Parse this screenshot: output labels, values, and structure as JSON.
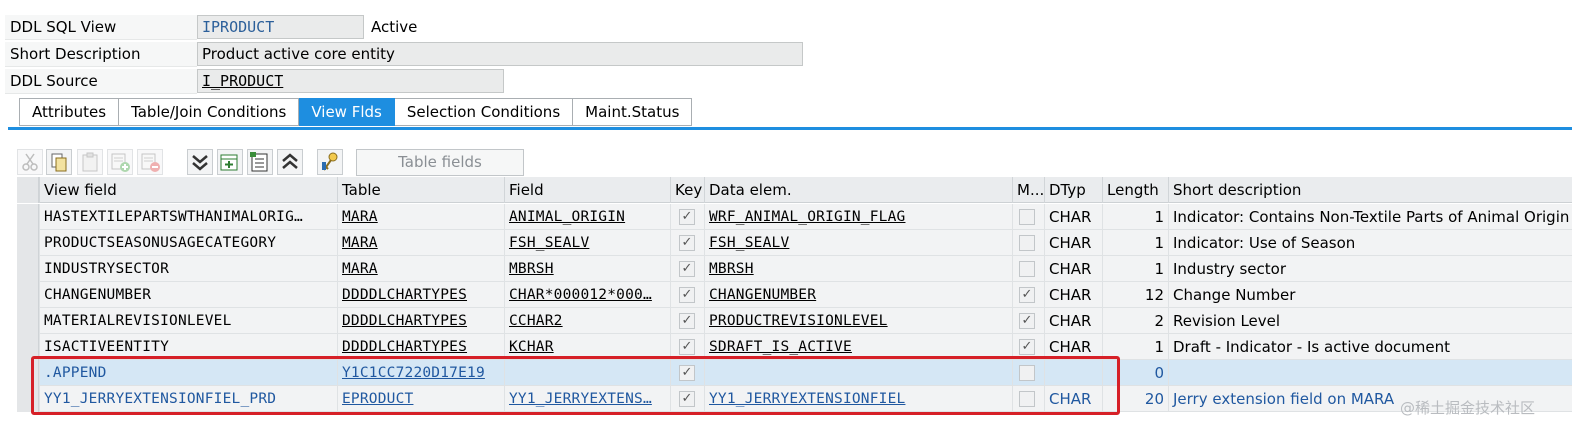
{
  "header": {
    "ddl_sql_view_label": "DDL SQL View",
    "ddl_sql_view_value": "IPRODUCT",
    "status": "Active",
    "short_desc_label": "Short Description",
    "short_desc_value": "Product active core entity",
    "ddl_source_label": "DDL Source",
    "ddl_source_value": "I_PRODUCT"
  },
  "tabs": [
    "Attributes",
    "Table/Join Conditions",
    "View Flds",
    "Selection Conditions",
    "Maint.Status"
  ],
  "active_tab": "View Flds",
  "toolbar": {
    "icons": [
      "cut-icon",
      "copy-icon",
      "paste-icon",
      "insert-row-icon",
      "delete-row-icon",
      "expand-all-icon",
      "insert-field-icon",
      "select-fields-icon",
      "collapse-all-icon",
      "key-icon"
    ],
    "table_fields_label": "Table fields"
  },
  "grid": {
    "columns": [
      "View field",
      "Table",
      "Field",
      "Key",
      "Data elem.",
      "M...",
      "DTyp",
      "Length",
      "Short description"
    ],
    "rows": [
      {
        "view_field": "HASTEXTILEPARTSWTHANIMALORIG…",
        "table": "MARA",
        "field": "ANIMAL_ORIGIN",
        "key": true,
        "data_elem": "WRF_ANIMAL_ORIGIN_FLAG",
        "mod": false,
        "dtyp": "CHAR",
        "length": "1",
        "desc": "Indicator: Contains Non-Textile Parts of Animal Origin"
      },
      {
        "view_field": "PRODUCTSEASONUSAGECATEGORY",
        "table": "MARA",
        "field": "FSH_SEALV",
        "key": true,
        "data_elem": "FSH_SEALV",
        "mod": false,
        "dtyp": "CHAR",
        "length": "1",
        "desc": "Indicator: Use of Season"
      },
      {
        "view_field": "INDUSTRYSECTOR",
        "table": "MARA",
        "field": "MBRSH",
        "key": true,
        "data_elem": "MBRSH",
        "mod": false,
        "dtyp": "CHAR",
        "length": "1",
        "desc": "Industry sector"
      },
      {
        "view_field": "CHANGENUMBER",
        "table": "DDDDLCHARTYPES",
        "field": "CHAR*000012*000…",
        "key": true,
        "data_elem": "CHANGENUMBER",
        "mod": true,
        "dtyp": "CHAR",
        "length": "12",
        "desc": "Change Number"
      },
      {
        "view_field": "MATERIALREVISIONLEVEL",
        "table": "DDDDLCHARTYPES",
        "field": "CCHAR2",
        "key": true,
        "data_elem": "PRODUCTREVISIONLEVEL",
        "mod": true,
        "dtyp": "CHAR",
        "length": "2",
        "desc": "Revision Level"
      },
      {
        "view_field": "ISACTIVEENTITY",
        "table": "DDDDLCHARTYPES",
        "field": "KCHAR",
        "key": true,
        "data_elem": "SDRAFT_IS_ACTIVE",
        "mod": true,
        "dtyp": "CHAR",
        "length": "1",
        "desc": "Draft - Indicator - Is active document"
      },
      {
        "view_field": ".APPEND",
        "table": "Y1C1CC7220D17E19",
        "field": "",
        "key": true,
        "data_elem": "",
        "mod": false,
        "dtyp": "",
        "length": "0",
        "desc": "",
        "selected": true
      },
      {
        "view_field": "YY1_JERRYEXTENSIONFIEL_PRD",
        "table": "EPRODUCT",
        "field": "YY1_JERRYEXTENS…",
        "key": true,
        "data_elem": "YY1_JERRYEXTENSIONFIEL",
        "mod": false,
        "dtyp": "CHAR",
        "length": "20",
        "desc": "Jerry extension field on MARA",
        "blue": true
      }
    ]
  },
  "watermark": "@稀土掘金技术社区",
  "colors": {
    "accent": "#1e8ee0",
    "highlight_box": "#d62027",
    "selected_row": "#d5e7f5",
    "link": "#2058a0"
  }
}
